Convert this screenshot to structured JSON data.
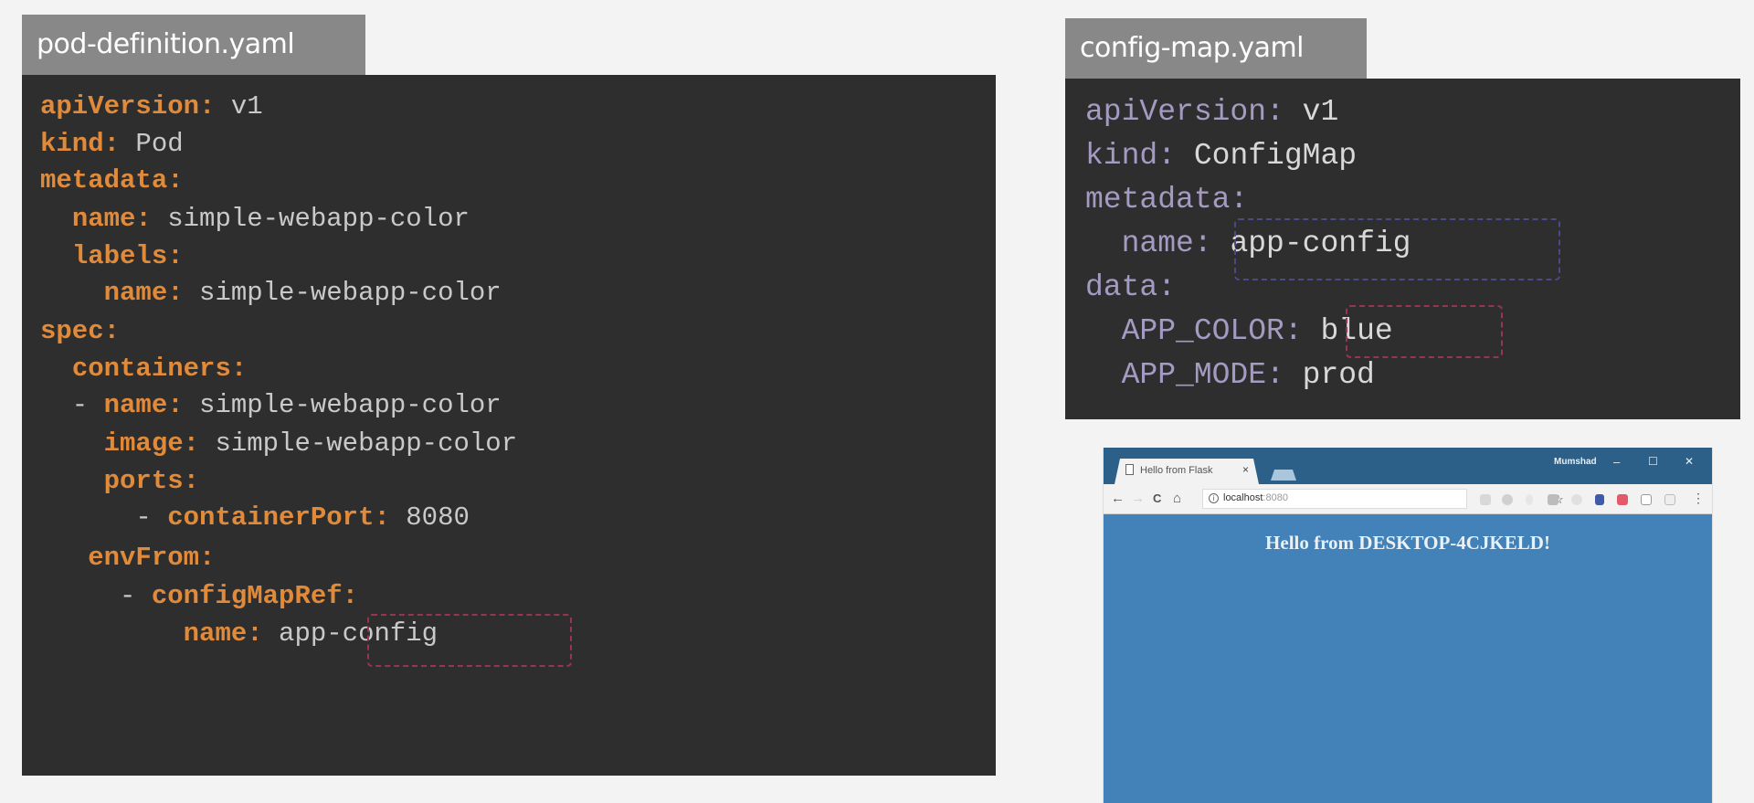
{
  "pod_file": {
    "title": "pod-definition.yaml",
    "lines": [
      {
        "indent": "",
        "key": "apiVersion:",
        "value": " v1"
      },
      {
        "indent": "",
        "key": "kind:",
        "value": " Pod"
      },
      {
        "indent": "",
        "key": "metadata:",
        "value": ""
      },
      {
        "indent": "  ",
        "key": "name:",
        "value": " simple-webapp-color"
      },
      {
        "indent": "  ",
        "key": "labels:",
        "value": ""
      },
      {
        "indent": "    ",
        "key": "name:",
        "value": " simple-webapp-color"
      },
      {
        "indent": "",
        "key": "spec:",
        "value": ""
      },
      {
        "indent": "  ",
        "key": "containers:",
        "value": ""
      },
      {
        "indent": "  - ",
        "key": "name:",
        "value": " simple-webapp-color"
      },
      {
        "indent": "    ",
        "key": "image:",
        "value": " simple-webapp-color"
      },
      {
        "indent": "    ",
        "key": "ports:",
        "value": ""
      },
      {
        "indent": "      - ",
        "key": "containerPort:",
        "value": " 8080"
      },
      {
        "indent": "   ",
        "key": "envFrom:",
        "value": ""
      },
      {
        "indent": "     - ",
        "key": "configMapRef:",
        "value": ""
      },
      {
        "indent": "         ",
        "key": "name:",
        "value": " app-config"
      }
    ]
  },
  "configmap_file": {
    "title": "config-map.yaml",
    "lines": [
      {
        "indent": "",
        "key": "apiVersion:",
        "value": " v1"
      },
      {
        "indent": "",
        "key": "kind:",
        "value": " ConfigMap"
      },
      {
        "indent": "",
        "key": "metadata:",
        "value": ""
      },
      {
        "indent": "  ",
        "key": "name:",
        "value": " app-config"
      },
      {
        "indent": "",
        "key": "data:",
        "value": ""
      },
      {
        "indent": "  ",
        "key": "APP_COLOR:",
        "value": " blue"
      },
      {
        "indent": "  ",
        "key": "APP_MODE:",
        "value": " prod"
      }
    ]
  },
  "browser": {
    "tab_title": "Hello from Flask",
    "tab_close": "×",
    "user_name": "Mumshad",
    "minimize": "–",
    "maximize": "☐",
    "close": "✕",
    "back": "←",
    "forward": "→",
    "reload": "C",
    "home": "⌂",
    "info": "i",
    "url_host": "localhost",
    "url_port": ":8080",
    "star": "☆",
    "menu": "⋮",
    "page_heading": "Hello from DESKTOP-4CJKELD!",
    "page_background": "#4282b8"
  }
}
